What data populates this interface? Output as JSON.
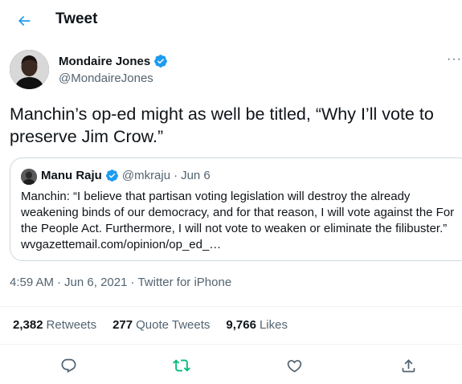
{
  "header": {
    "title": "Tweet",
    "back_icon": "arrow-left-icon",
    "accent_color": "#1d9bf0"
  },
  "tweet": {
    "author_name": "Mondaire Jones",
    "author_handle": "@MondaireJones",
    "verified_icon": "verified-badge-icon",
    "more_icon": "more-horizontal-icon",
    "more_label": "···",
    "text": "Manchin’s op-ed might as well be titled, “Why I’ll vote to preserve Jim Crow.”"
  },
  "quote": {
    "author_name": "Manu Raju",
    "author_handle": "@mkraju",
    "separator": "·",
    "date": "Jun 6",
    "text": "Manchin: “I believe that partisan voting legislation will destroy the already weakening binds of our democracy, and for that reason, I will vote against the For the People Act. Furthermore, I will not vote to weaken or eliminate the filibuster.” wvgazettemail.com/opinion/op_ed_…"
  },
  "meta": {
    "time": "4:59 AM",
    "separator": "·",
    "date": "Jun 6, 2021",
    "source": "Twitter for iPhone"
  },
  "stats": {
    "retweets_count": "2,382",
    "retweets_label": "Retweets",
    "quotes_count": "277",
    "quotes_label": "Quote Tweets",
    "likes_count": "9,766",
    "likes_label": "Likes"
  },
  "actions": {
    "reply_icon": "reply-icon",
    "retweet_icon": "retweet-icon",
    "like_icon": "heart-icon",
    "share_icon": "share-icon",
    "retweet_color": "#00ba7c"
  }
}
